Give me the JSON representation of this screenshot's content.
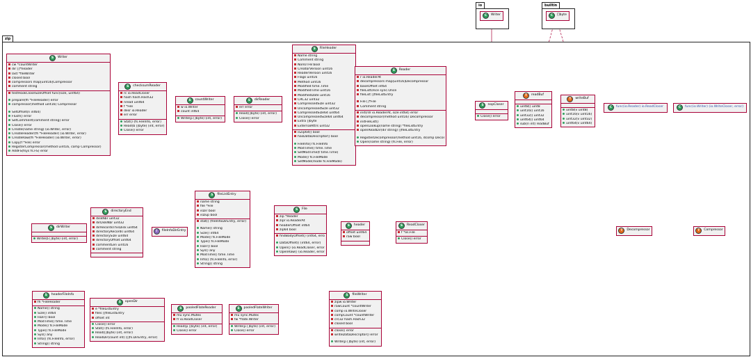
{
  "packages": {
    "io": "io",
    "builtin": "builtin",
    "zip": "zip"
  },
  "colors": {
    "class_badge": "#2e9e5b",
    "type_badge": "#e06a1b",
    "iface_badge": "#8a6bbf",
    "border": "#a80036",
    "fill": "#f1f1f1"
  },
  "classes": {
    "io_writer": {
      "name": "Writer",
      "badge": "C",
      "fields": [],
      "methods": []
    },
    "byte_slice": {
      "name": "[]byte",
      "badge": "C",
      "fields": [],
      "methods": []
    },
    "writer": {
      "name": "Writer",
      "badge": "S",
      "fields": [
        "cw *countWriter",
        "dir []*header",
        "last *fileWriter",
        "closed bool",
        "compressors map[uint16]Compressor",
        "comment string"
      ],
      "private_methods": [
        "testHookCloseSizeOffset func(size, uint64)"
      ],
      "methods": [
        "prepare(fh *FileHeader) error",
        "compressor(method uint16) Compressor",
        "",
        "SetOffset(n int64)",
        "Flush() error",
        "SetComment(comment string) error",
        "Close() error",
        "Create(name string) (io.Writer, error)",
        "CreateHeader(fh *FileHeader) (io.Writer, error)",
        "CreateRaw(fh *FileHeader) (io.Writer, error)",
        "Copy(f *File) error",
        "RegisterCompressor(method uint16, comp Compressor)",
        "AddFS(fsys fs.FS) error"
      ]
    },
    "checksumReader": {
      "name": "checksumReader",
      "badge": "S",
      "fields": [
        "rc io.ReadCloser",
        "hash hash.Hash32",
        "nread uint64",
        "f *File",
        "desr io.Reader",
        "err error"
      ],
      "methods": [
        "Stat() (fs.FileInfo, error)",
        "Read(b []byte) (int, error)",
        "Close() error"
      ]
    },
    "countWriter": {
      "name": "countWriter",
      "badge": "S",
      "fields": [
        "w io.Writer",
        "count int64"
      ],
      "methods": [
        "Write(p []byte) (int, error)"
      ]
    },
    "dirReader": {
      "name": "dirReader",
      "badge": "S",
      "fields": [
        "err error"
      ],
      "methods": [
        "Read([]byte) (int, error)",
        "Close() error"
      ]
    },
    "fileHeader": {
      "name": "FileHeader",
      "badge": "S",
      "fields": [
        "Name string",
        "Comment string",
        "NonUTF8 bool",
        "CreatorVersion uint16",
        "ReaderVersion uint16",
        "Flags uint16",
        "Method uint16",
        "Modified time.Time",
        "ModifiedTime uint16",
        "ModifiedDate uint16",
        "CRC32 uint32",
        "CompressedSize uint32",
        "UncompressedSize uint32",
        "CompressedSize64 uint64",
        "UncompressedSize64 uint64",
        "Extra []byte",
        "ExternalAttrs uint32"
      ],
      "private_methods": [
        "isZip64() bool",
        "hasDataDescriptor() bool"
      ],
      "methods": [
        "FileInfo() fs.FileInfo",
        "ModTime() time.Time",
        "SetModTime(t time.Time)",
        "Mode() fs.FileMode",
        "SetMode(mode fs.FileMode)"
      ]
    },
    "reader": {
      "name": "Reader",
      "badge": "S",
      "fields": [
        "r io.ReaderAt",
        "decompressors map[uint16]Decompressor",
        "baseOffset int64",
        "fileListOnce sync.Once",
        "fileList []fileListEntry",
        "",
        "File []*File",
        "Comment string"
      ],
      "private_methods": [
        "init(rdr io.ReaderAt, size int64) error",
        "decompressor(method uint16) Decompressor",
        "initFileList()",
        "openLookup(name string) *fileListEntry",
        "openReadDir(dir string) []fileListEntry"
      ],
      "methods": [
        "RegisterDecompressor(method uint16, dcomp Decompressor)",
        "Open(name string) (fs.File, error)"
      ]
    },
    "nopCloser": {
      "name": "nopCloser",
      "badge": "S",
      "fields": [],
      "methods": [
        "Close() error"
      ]
    },
    "readBuf": {
      "name": "readBuf",
      "badge": "T",
      "fields": [],
      "methods": [
        "uint8() uint8",
        "uint16() uint16",
        "uint32() uint32",
        "uint64() uint64",
        "sub(n int) readBuf"
      ]
    },
    "writeBuf": {
      "name": "writeBuf",
      "badge": "T",
      "fields": [],
      "methods": [
        "uint8(v uint8)",
        "uint16(v uint16)",
        "uint32(v uint32)",
        "uint64(v uint64)"
      ]
    },
    "funcReader": {
      "name": "func(io.Reader) io.ReadCloser",
      "badge": "C",
      "fields": [],
      "methods": []
    },
    "funcWriter": {
      "name": "func(io.Writer) (io.WriteCloser, error)",
      "badge": "C",
      "fields": [],
      "methods": []
    },
    "fileListEntry": {
      "name": "fileListEntry",
      "badge": "S",
      "fields": [
        "name string",
        "file *File",
        "isDir bool",
        "isDup bool"
      ],
      "private_methods": [
        "stat() (fileInfoDirEntry, error)"
      ],
      "methods": [
        "Name() string",
        "Size() int64",
        "Mode() fs.FileMode",
        "Type() fs.FileMode",
        "IsDir() bool",
        "Sys() any",
        "ModTime() time.Time",
        "Info() (fs.FileInfo, error)",
        "String() string"
      ]
    },
    "directoryEnd": {
      "name": "directoryEnd",
      "badge": "S",
      "fields": [
        "diskNbr uint32",
        "dirDiskNbr uint32",
        "dirRecordsThisDisk uint64",
        "directoryRecords uint64",
        "directorySize uint64",
        "directoryOffset uint64",
        "commentLen uint16",
        "comment string"
      ],
      "methods": []
    },
    "fileInfoDirEntry": {
      "name": "fileInfoDirEntry",
      "badge": "I",
      "fields": [],
      "methods": []
    },
    "dirWriter": {
      "name": "dirWriter",
      "badge": "S",
      "fields": [],
      "methods": [
        "Write(b []byte) (int, error)"
      ]
    },
    "file": {
      "name": "File",
      "badge": "S",
      "fields": [
        "zip *Reader",
        "zipr io.ReaderAt",
        "headerOffset int64",
        "zip64 bool"
      ],
      "private_methods": [
        "findBodyOffset() (int64, error)"
      ],
      "methods": [
        "DataOffset() (int64, error)",
        "Open() (io.ReadCloser, error)",
        "OpenRaw() (io.Reader, error)"
      ]
    },
    "header": {
      "name": "header",
      "badge": "S",
      "fields": [
        "offset uint64",
        "raw bool"
      ],
      "methods": []
    },
    "readCloser": {
      "name": "ReadCloser",
      "badge": "S",
      "fields": [
        "f *os.File"
      ],
      "methods": [
        "Close() error"
      ]
    },
    "decompressor": {
      "name": "Decompressor",
      "badge": "T",
      "fields": [],
      "methods": []
    },
    "compressor": {
      "name": "Compressor",
      "badge": "T",
      "fields": [],
      "methods": []
    },
    "headerFileInfo": {
      "name": "headerFileInfo",
      "badge": "S",
      "fields": [
        "fh *FileHeader"
      ],
      "methods": [
        "Name() string",
        "Size() int64",
        "IsDir() bool",
        "ModTime() time.Time",
        "Mode() fs.FileMode",
        "Type() fs.FileMode",
        "Sys() any",
        "Info() (fs.FileInfo, error)",
        "String() string"
      ]
    },
    "openDir": {
      "name": "openDir",
      "badge": "S",
      "fields": [
        "e *fileListEntry",
        "files []fileListEntry",
        "offset int"
      ],
      "methods": [
        "Close() error",
        "Stat() (fs.FileInfo, error)",
        "Read([]byte) (int, error)",
        "ReadDir(count int) ([]fs.DirEntry, error)"
      ]
    },
    "pooledFlateReader": {
      "name": "pooledFlateReader",
      "badge": "S",
      "fields": [
        "mu sync.Mutex",
        "fr io.ReadCloser"
      ],
      "methods": [
        "Read(p []byte) (int, error)",
        "Close() error"
      ]
    },
    "pooledFlateWriter": {
      "name": "pooledFlateWriter",
      "badge": "S",
      "fields": [
        "mu sync.Mutex",
        "fw *flate.Writer"
      ],
      "methods": [
        "Write(p []byte) (int, error)",
        "Close() error"
      ]
    },
    "fileWriter": {
      "name": "fileWriter",
      "badge": "S",
      "fields": [
        "zipw io.Writer",
        "rawCount *countWriter",
        "comp io.WriteCloser",
        "compCount *countWriter",
        "crc32 hash.Hash32",
        "closed bool"
      ],
      "private_methods": [
        "close() error",
        "writeDataDescriptor() error"
      ],
      "methods": [
        "Write(p []byte) (int, error)"
      ]
    }
  }
}
